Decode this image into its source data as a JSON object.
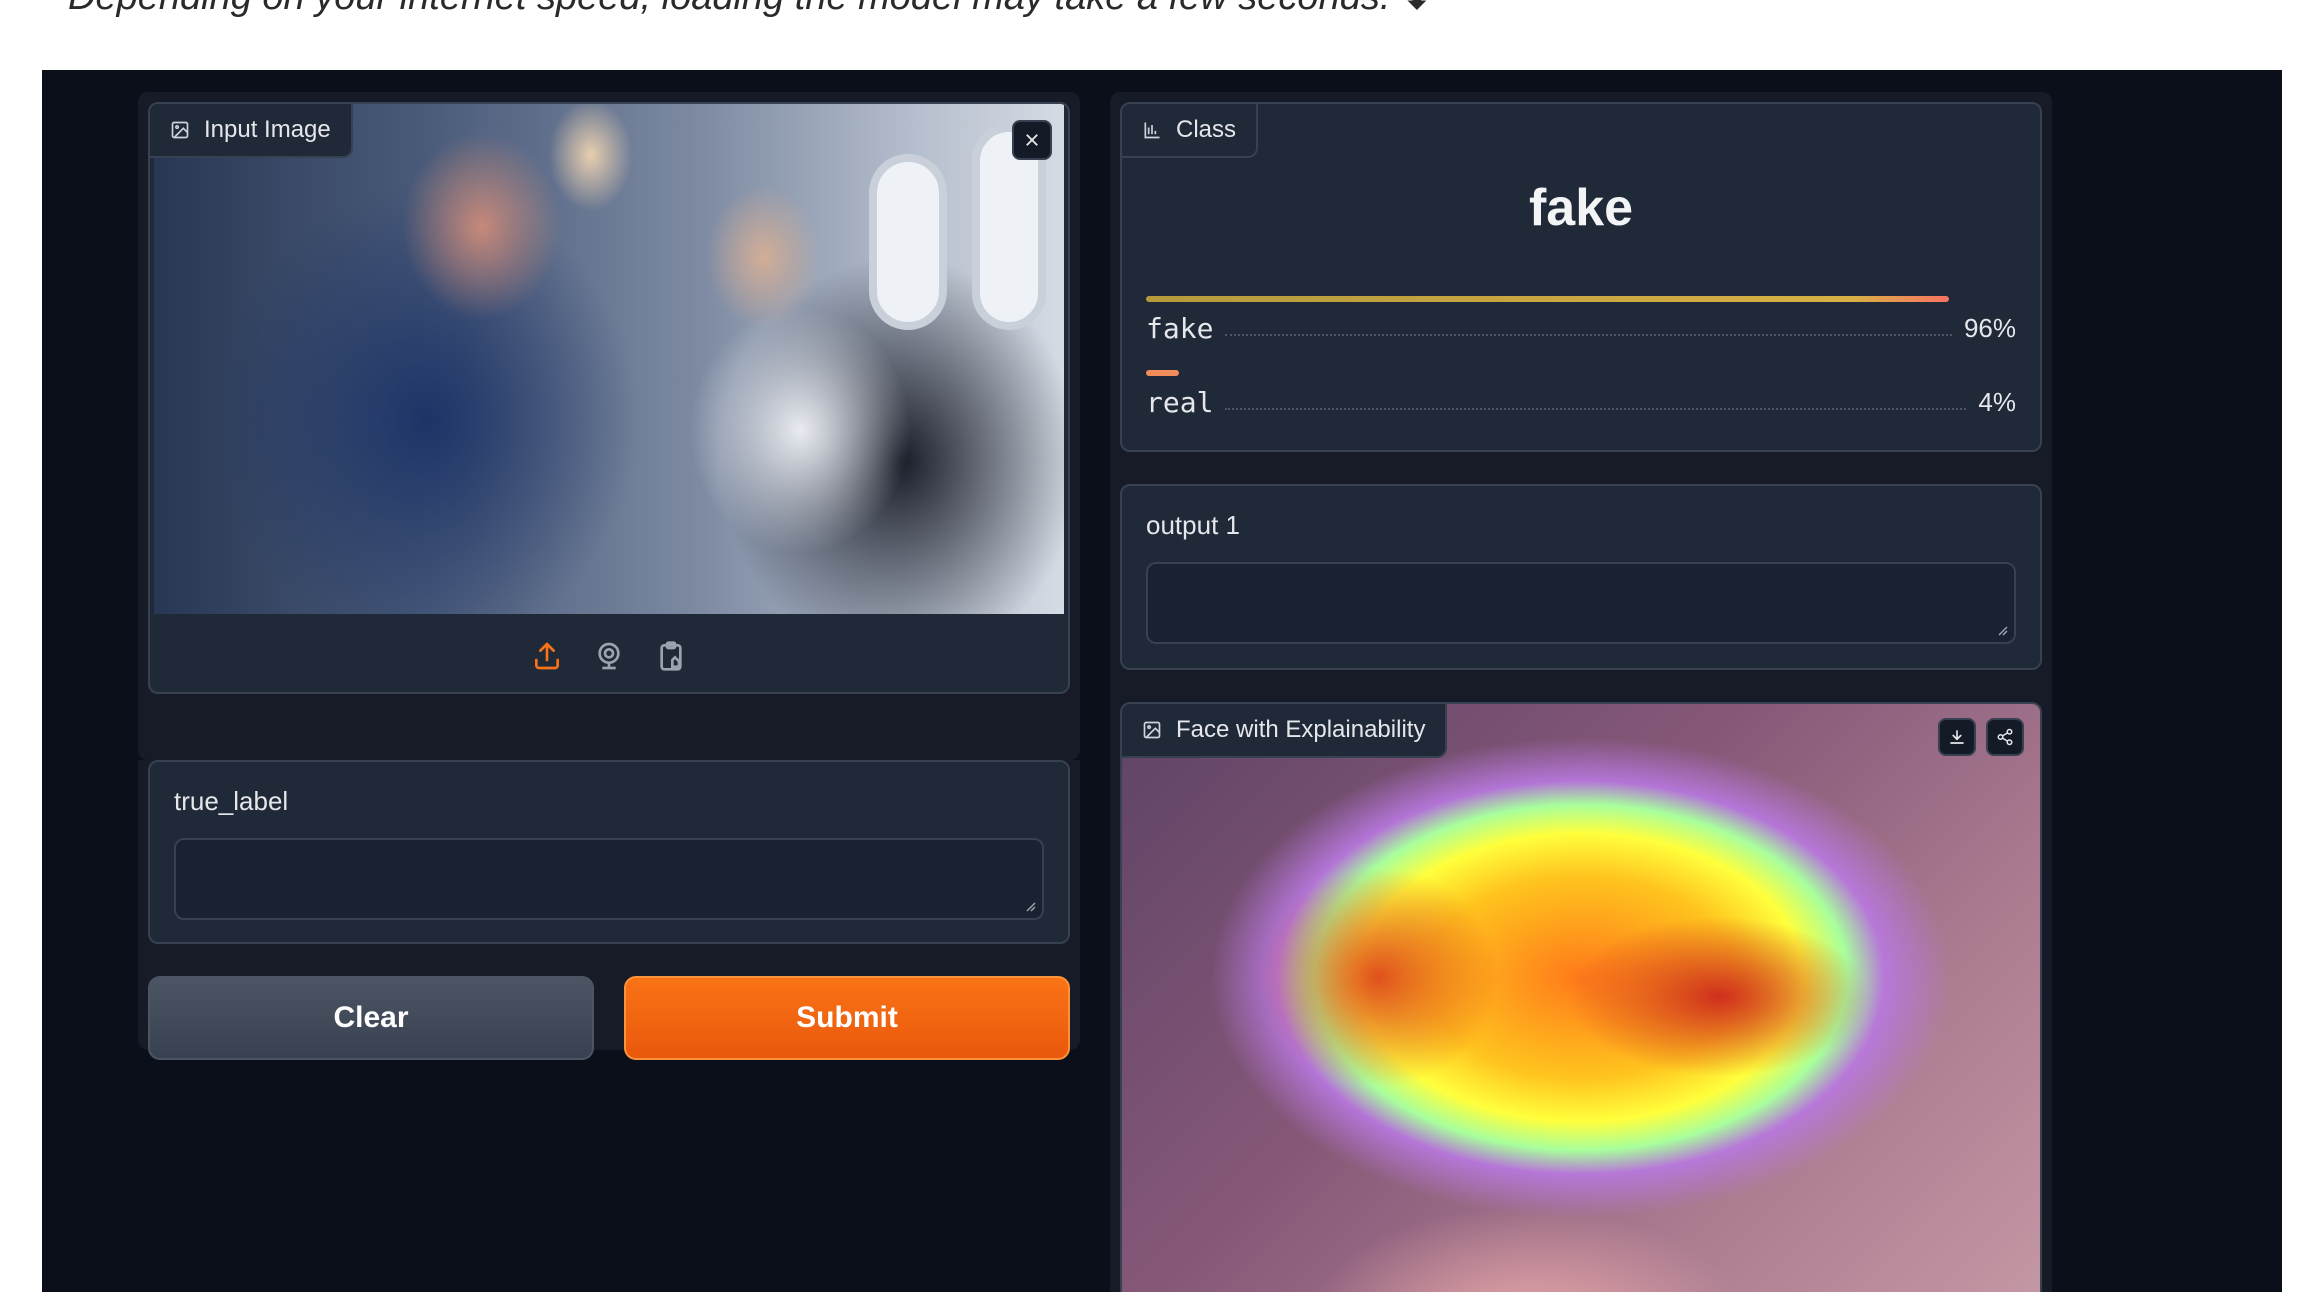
{
  "caption": "Depending on your internet speed, loading the model may take a few seconds. ⬇",
  "input_image": {
    "label": "Input Image"
  },
  "true_label": {
    "label": "true_label",
    "value": ""
  },
  "buttons": {
    "clear": "Clear",
    "submit": "Submit"
  },
  "class_output": {
    "label": "Class",
    "top_class": "fake",
    "confidences": [
      {
        "name": "fake",
        "percent_text": "96%",
        "fraction": 0.96
      },
      {
        "name": "real",
        "percent_text": "4%",
        "fraction": 0.04
      }
    ]
  },
  "output_1": {
    "label": "output 1",
    "value": ""
  },
  "explain": {
    "label": "Face with Explainability"
  },
  "icons": {
    "image": "image-icon",
    "close": "close-icon",
    "upload": "upload-icon",
    "webcam": "webcam-icon",
    "clipboard": "clipboard-icon",
    "chart": "bar-chart-icon",
    "download": "download-icon",
    "share": "share-icon"
  },
  "colors": {
    "app_bg": "#0b0f19",
    "panel_bg": "#1f2937",
    "border": "#374151",
    "accent": "#f97316",
    "text": "#e5e7eb"
  }
}
